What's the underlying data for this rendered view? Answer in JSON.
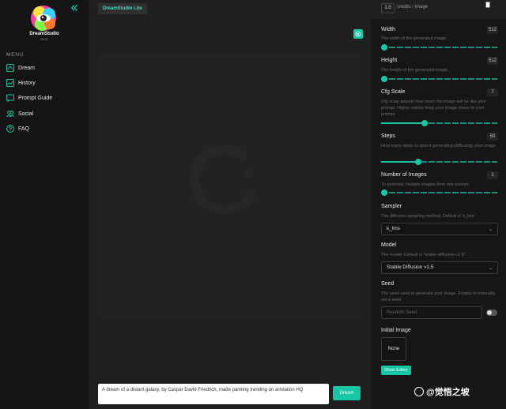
{
  "app": {
    "brand": "DreamStudio",
    "brand_sub": "Beta",
    "title_pill": "DreamStudio Lite"
  },
  "sidebar": {
    "menu_label": "MENU",
    "items": [
      {
        "label": "Dream",
        "icon": "dream-icon"
      },
      {
        "label": "History",
        "icon": "history-icon"
      },
      {
        "label": "Prompt Guide",
        "icon": "guide-icon"
      },
      {
        "label": "Social",
        "icon": "social-icon"
      },
      {
        "label": "FAQ",
        "icon": "help-icon"
      }
    ]
  },
  "credits": {
    "value": "1.0",
    "label": "credits / image"
  },
  "prompt": {
    "text": "A dream of a distant galaxy, by Caspar David Friedrich, matte painting trending on artstation HQ",
    "button": "Dream"
  },
  "settings": {
    "width": {
      "label": "Width",
      "desc": "The width of the generated image.",
      "value": "512",
      "fraction": 0.0
    },
    "height": {
      "label": "Height",
      "desc": "The height of the generated image.",
      "value": "512",
      "fraction": 0.0
    },
    "cfg": {
      "label": "Cfg Scale",
      "desc": "Cfg scale adjusts how much the image will be like your prompt. Higher values keep your image closer to your prompt.",
      "value": "7",
      "fraction": 0.35
    },
    "steps": {
      "label": "Steps",
      "desc": "How many steps to spend generating (diffusing) your image.",
      "value": "50",
      "fraction": 0.29
    },
    "num_images": {
      "label": "Number of Images",
      "desc": "To generate multiple images from one prompt",
      "value": "1",
      "fraction": 0.0
    },
    "sampler": {
      "label": "Sampler",
      "desc": "The diffusion sampling method. Default is 'k_lms'.",
      "value": "k_lms"
    },
    "model": {
      "label": "Model",
      "desc": "The model. Default is \"stable-diffusion-v1-5\".",
      "value": "Stable Diffusion v1.5"
    },
    "seed": {
      "label": "Seed",
      "desc": "The seed used to generate your image. Enable to manually set a seed.",
      "placeholder": "Random Seed"
    },
    "init_image": {
      "label": "Initial Image",
      "value": "None",
      "button": "Show Editor"
    }
  },
  "watermark": "@觉悟之坡",
  "colors": {
    "accent": "#16c7a5",
    "accent_text": "#2ee6c0",
    "sidebar": "#141414",
    "panel": "#161616"
  }
}
